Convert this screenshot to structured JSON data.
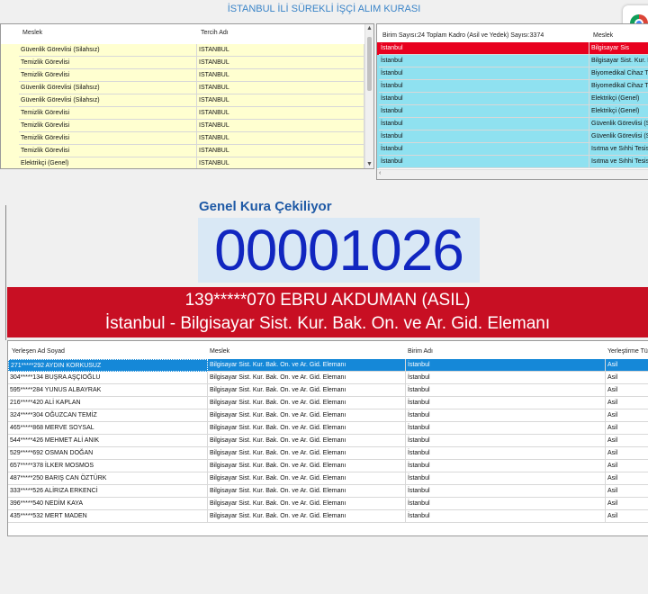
{
  "app": {
    "title": "İSTANBUL İLİ SÜREKLİ İŞÇİ ALIM KURASI"
  },
  "top_left": {
    "columns": [
      "Meslek",
      "Tercih Adı"
    ],
    "rows": [
      [
        "Güvenlik Görevlisi (Silahsız)",
        "ISTANBUL"
      ],
      [
        "Temizlik Görevlisi",
        "ISTANBUL"
      ],
      [
        "Temizlik Görevlisi",
        "ISTANBUL"
      ],
      [
        "Güvenlik Görevlisi (Silahsız)",
        "ISTANBUL"
      ],
      [
        "Güvenlik Görevlisi (Silahsız)",
        "ISTANBUL"
      ],
      [
        "Temizlik Görevlisi",
        "ISTANBUL"
      ],
      [
        "Temizlik Görevlisi",
        "ISTANBUL"
      ],
      [
        "Temizlik Görevlisi",
        "ISTANBUL"
      ],
      [
        "Temizlik Görevlisi",
        "ISTANBUL"
      ],
      [
        "Elektrikçi (Genel)",
        "ISTANBUL"
      ]
    ]
  },
  "top_right": {
    "columns": [
      "Birim Sayısı:24 Toplam Kadro (Asil ve Yedek) Sayısı:3374",
      "Meslek"
    ],
    "rows": [
      [
        "İstanbul",
        "Bilgisayar Sis"
      ],
      [
        "İstanbul",
        "Bilgisayar Sist. Kur. Ba"
      ],
      [
        "İstanbul",
        "Biyomedikal Cihaz Te"
      ],
      [
        "İstanbul",
        "Biyomedikal Cihaz Te"
      ],
      [
        "İstanbul",
        "Elektrikçi (Genel)"
      ],
      [
        "İstanbul",
        "Elektrikçi (Genel)"
      ],
      [
        "İstanbul",
        "Güvenlik Görevlisi (Sil"
      ],
      [
        "İstanbul",
        "Güvenlik Görevlisi (Sil"
      ],
      [
        "İstanbul",
        "Isıtma ve Sıhhi Tesisa"
      ],
      [
        "İstanbul",
        "Isıtma ve Sıhhi Tesisa"
      ]
    ]
  },
  "draw": {
    "label": "Genel Kura Çekiliyor",
    "counter": "00001026",
    "winner_line1": "139*****070 EBRU AKDUMAN (ASIL)",
    "winner_line2": "İstanbul - Bilgisayar Sist. Kur. Bak. On. ve Ar. Gid. Elemanı"
  },
  "results": {
    "columns": [
      "Yerleşen Ad Soyad",
      "Meslek",
      "Birim Adı",
      "Yerleştirme Tür"
    ],
    "rows": [
      [
        "271*****292 AYDIN KORKUSUZ",
        "Bilgisayar Sist. Kur. Bak. On. ve Ar. Gid. Elemanı",
        "İstanbul",
        "Asil"
      ],
      [
        "304*****134 BUŞRA AŞÇIOĞLU",
        "Bilgisayar Sist. Kur. Bak. On. ve Ar. Gid. Elemanı",
        "İstanbul",
        "Asil"
      ],
      [
        "595*****284 YUNUS ALBAYRAK",
        "Bilgisayar Sist. Kur. Bak. On. ve Ar. Gid. Elemanı",
        "İstanbul",
        "Asil"
      ],
      [
        "216*****420 ALİ KAPLAN",
        "Bilgisayar Sist. Kur. Bak. On. ve Ar. Gid. Elemanı",
        "İstanbul",
        "Asil"
      ],
      [
        "324*****304 OĞUZCAN TEMİZ",
        "Bilgisayar Sist. Kur. Bak. On. ve Ar. Gid. Elemanı",
        "İstanbul",
        "Asil"
      ],
      [
        "465*****868 MERVE SOYSAL",
        "Bilgisayar Sist. Kur. Bak. On. ve Ar. Gid. Elemanı",
        "İstanbul",
        "Asil"
      ],
      [
        "544*****426 MEHMET ALİ ANIK",
        "Bilgisayar Sist. Kur. Bak. On. ve Ar. Gid. Elemanı",
        "İstanbul",
        "Asil"
      ],
      [
        "529*****692 OSMAN DOĞAN",
        "Bilgisayar Sist. Kur. Bak. On. ve Ar. Gid. Elemanı",
        "İstanbul",
        "Asil"
      ],
      [
        "657*****378 İLKER MOSMOS",
        "Bilgisayar Sist. Kur. Bak. On. ve Ar. Gid. Elemanı",
        "İstanbul",
        "Asil"
      ],
      [
        "487*****250 BARIŞ CAN ÖZTÜRK",
        "Bilgisayar Sist. Kur. Bak. On. ve Ar. Gid. Elemanı",
        "İstanbul",
        "Asil"
      ],
      [
        "333*****526 ALİRIZA ERKENCİ",
        "Bilgisayar Sist. Kur. Bak. On. ve Ar. Gid. Elemanı",
        "İstanbul",
        "Asil"
      ],
      [
        "396*****540 NEDİM KAYA",
        "Bilgisayar Sist. Kur. Bak. On. ve Ar. Gid. Elemanı",
        "İstanbul",
        "Asil"
      ],
      [
        "435*****532 MERT MADEN",
        "Bilgisayar Sist. Kur. Bak. On. ve Ar. Gid. Elemanı",
        "İstanbul",
        "Asil"
      ]
    ]
  },
  "colors": {
    "top_left_row_bg": "#ffffd0",
    "top_right_row_bg": "#8fe1f0",
    "top_right_selected_bg": "#e8001e",
    "results_selected_bg": "#1588d8",
    "banner_bg": "#c80f23",
    "counter_text": "#1126c0"
  }
}
